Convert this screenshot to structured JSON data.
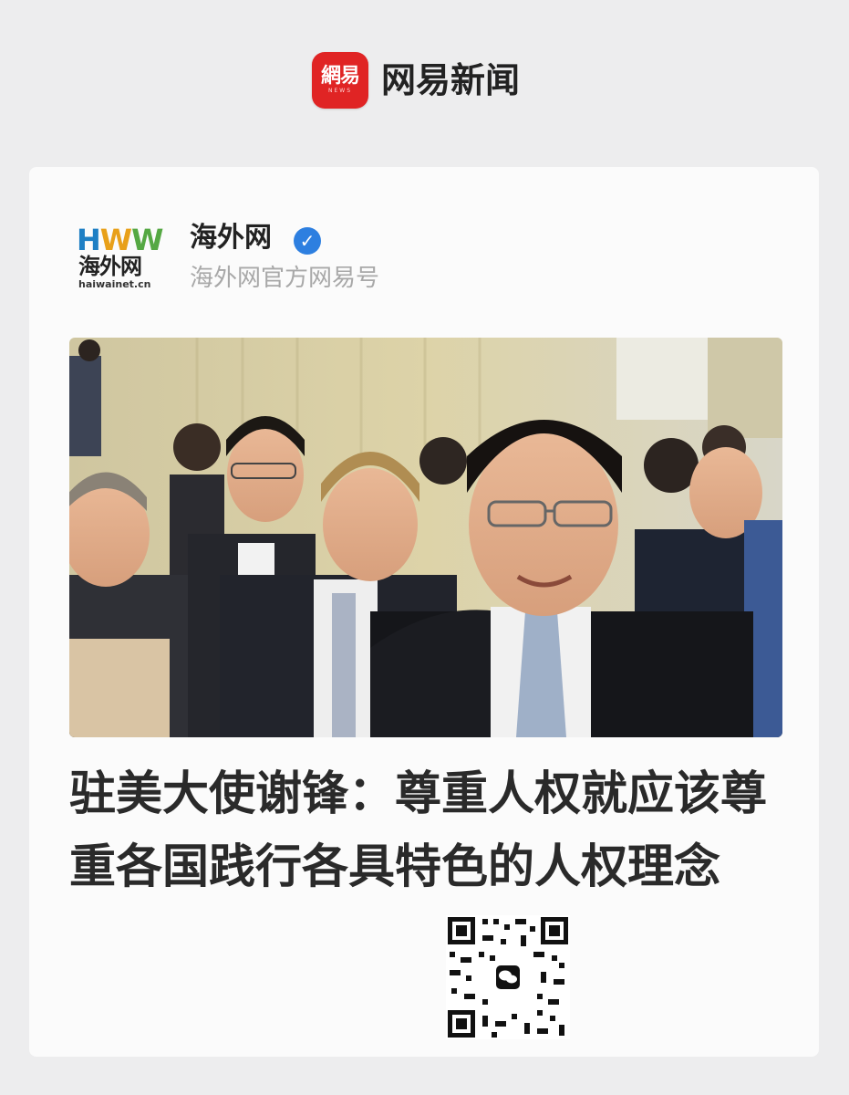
{
  "app": {
    "logo_glyph": "網易",
    "logo_sub": "NEWS",
    "name": "网易新闻",
    "accent_color": "#e02424"
  },
  "source": {
    "logo_letters": "HWW",
    "logo_cn": "海外网",
    "logo_url": "haiwainet.cn",
    "name": "海外网",
    "verified_icon": "check",
    "description": "海外网官方网易号"
  },
  "article": {
    "headline": "驻美大使谢锋：尊重人权就应该尊重各国践行各具特色的人权理念"
  },
  "icons": [
    "verified-icon",
    "wechat-icon",
    "qr-code"
  ]
}
